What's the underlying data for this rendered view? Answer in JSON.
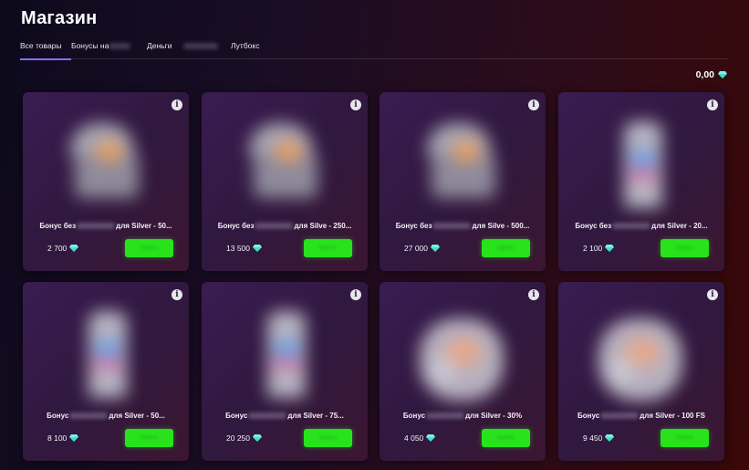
{
  "page": {
    "title": "Магазин"
  },
  "tabs": [
    {
      "label": "Все товары",
      "blurred_tail": false,
      "active": true
    },
    {
      "label": "Бонусы на",
      "blurred_tail": true,
      "active": false
    },
    {
      "label": "Деньги",
      "blurred_tail": true,
      "active": false
    },
    {
      "label": "Лутбокс",
      "blurred_tail": false,
      "active": false
    }
  ],
  "balance": {
    "value": "0,00",
    "icon": "gem-icon"
  },
  "colors": {
    "accent": "#8b6cf0",
    "buy": "#28e31c",
    "gem": "#3fe0d0"
  },
  "products": [
    {
      "name_prefix": "Бонус без",
      "name_suffix": "для Silver - 50...",
      "price": "2 700",
      "art": "chest",
      "button_label": "Купить"
    },
    {
      "name_prefix": "Бонус без",
      "name_suffix": "для Silve - 250...",
      "price": "13 500",
      "art": "chest",
      "button_label": "Купить"
    },
    {
      "name_prefix": "Бонус без",
      "name_suffix": "для Silve - 500...",
      "price": "27 000",
      "art": "chest",
      "button_label": "Купить"
    },
    {
      "name_prefix": "Бонус без",
      "name_suffix": "для Silver - 20...",
      "price": "2 100",
      "art": "slot",
      "button_label": "Купить"
    },
    {
      "name_prefix": "Бонус",
      "name_suffix": "для Silver - 50...",
      "price": "8 100",
      "art": "slot",
      "button_label": "Купить"
    },
    {
      "name_prefix": "Бонус",
      "name_suffix": "для Silver - 75...",
      "price": "20 250",
      "art": "slot",
      "button_label": "Купить"
    },
    {
      "name_prefix": "Бонус",
      "name_suffix": "для Silver - 30%",
      "price": "4 050",
      "art": "gift",
      "button_label": "Купить"
    },
    {
      "name_prefix": "Бонус",
      "name_suffix": "для Silver - 100 FS",
      "price": "9 450",
      "art": "gift",
      "button_label": "Купить"
    }
  ]
}
